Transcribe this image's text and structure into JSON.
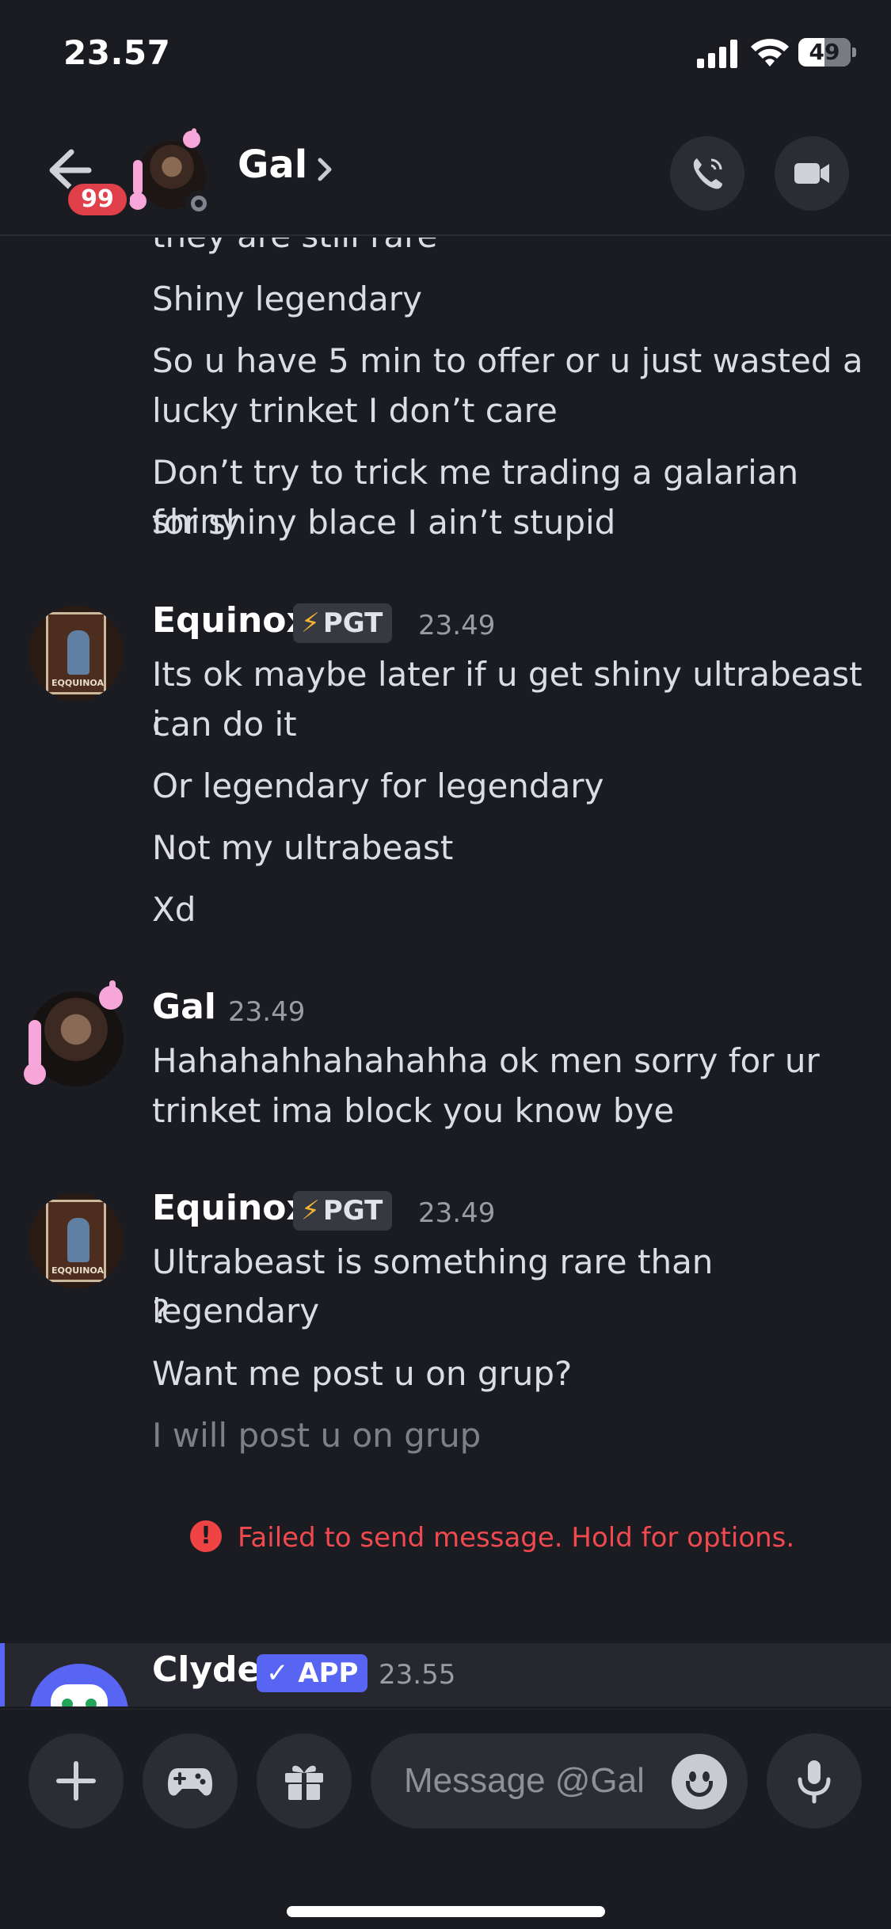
{
  "status_bar": {
    "time": "23.57",
    "battery": "49"
  },
  "header": {
    "title": "Gal",
    "unread_count": "99"
  },
  "chat": {
    "continued_lines": [
      "they are still rare",
      "Shiny legendary",
      "So u have 5 min to offer or u just wasted a",
      "lucky trinket I don’t care",
      "Don’t try to trick me trading a galarian shiny",
      "for shiny blace I ain’t stupid"
    ],
    "groups": [
      {
        "author": "Equinox",
        "tag": "PGT",
        "time": "23.49",
        "lines": [
          "Its ok maybe later if u get shiny ultrabeast i",
          "can do it",
          "Or legendary for legendary",
          "Not my ultrabeast",
          "Xd"
        ]
      },
      {
        "author": "Gal",
        "time": "23.49",
        "lines": [
          "Hahahahhahahahha ok men sorry for ur",
          "trinket ima block you know bye"
        ]
      },
      {
        "author": "Equinox",
        "tag": "PGT",
        "time": "23.49",
        "lines": [
          "Ultrabeast is something rare than legendary",
          "?",
          "Want me post u on grup?",
          "I will post u on grup"
        ]
      }
    ],
    "poster_label": "EQQUINOA",
    "error": "Failed to send message. Hold for options.",
    "clyde": {
      "author": "Clyde",
      "tag": "✓ APP",
      "time": "23.55"
    }
  },
  "composer": {
    "placeholder": "Message @Gal"
  },
  "colors": {
    "accent": "#5865f2",
    "error": "#f0494f",
    "background": "#1b1c21"
  }
}
